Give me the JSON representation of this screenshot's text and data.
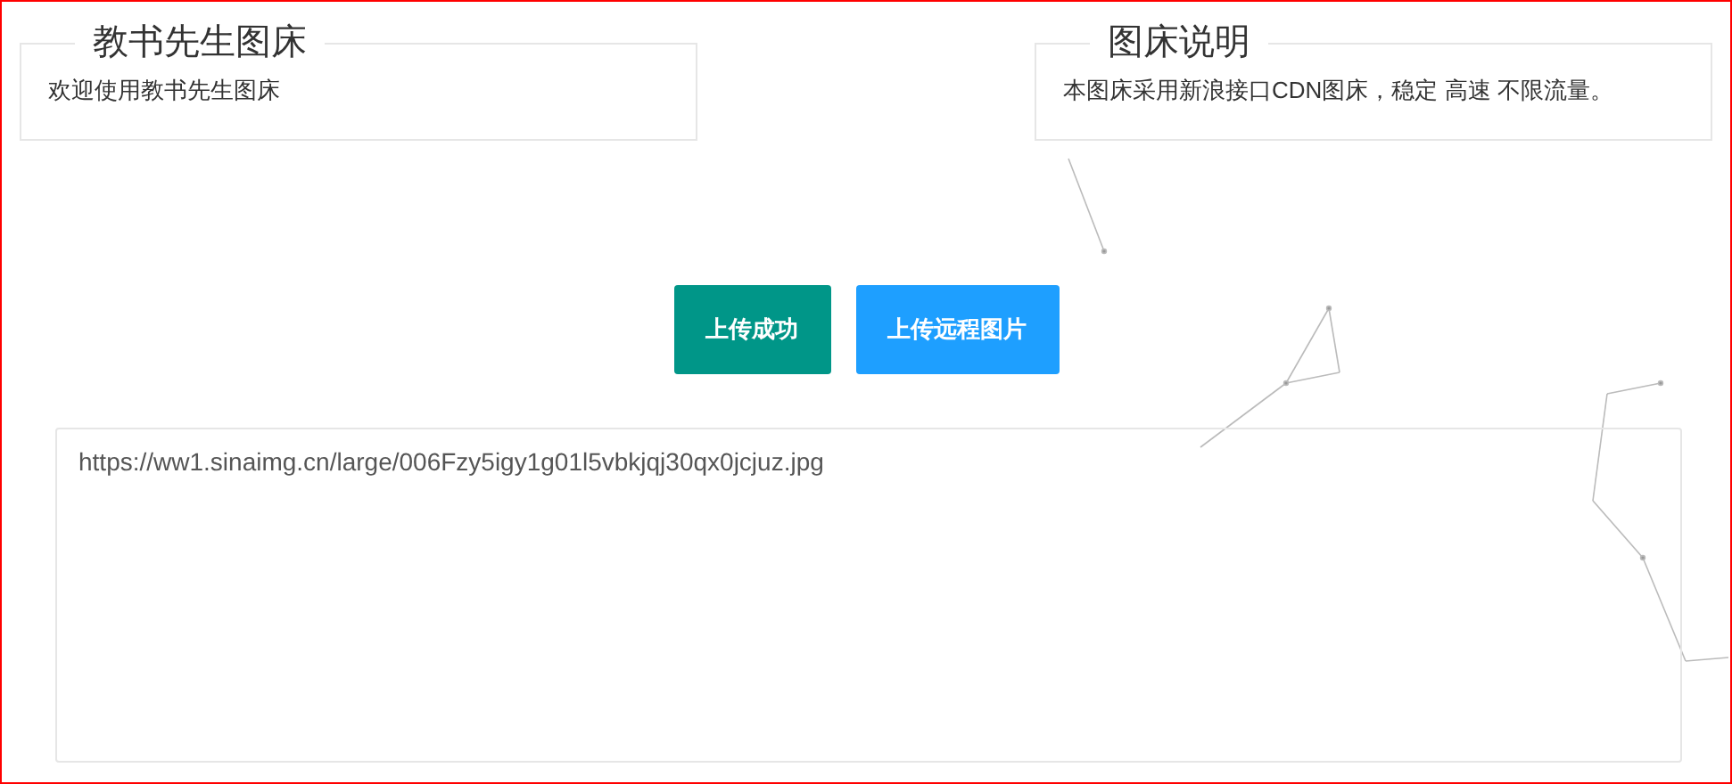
{
  "panels": [
    {
      "title": "教书先生图床",
      "text": "欢迎使用教书先生图床"
    },
    {
      "title": "图床说明",
      "text": "本图床采用新浪接口CDN图床，稳定 高速 不限流量。"
    }
  ],
  "buttons": [
    {
      "label": "上传成功",
      "color": "#009688"
    },
    {
      "label": "上传远程图片",
      "color": "#1e9fff"
    }
  ],
  "result": {
    "value": "https://ww1.sinaimg.cn/large/006Fzy5igy1g01l5vbkjqj30qx0jcjuz.jpg"
  }
}
